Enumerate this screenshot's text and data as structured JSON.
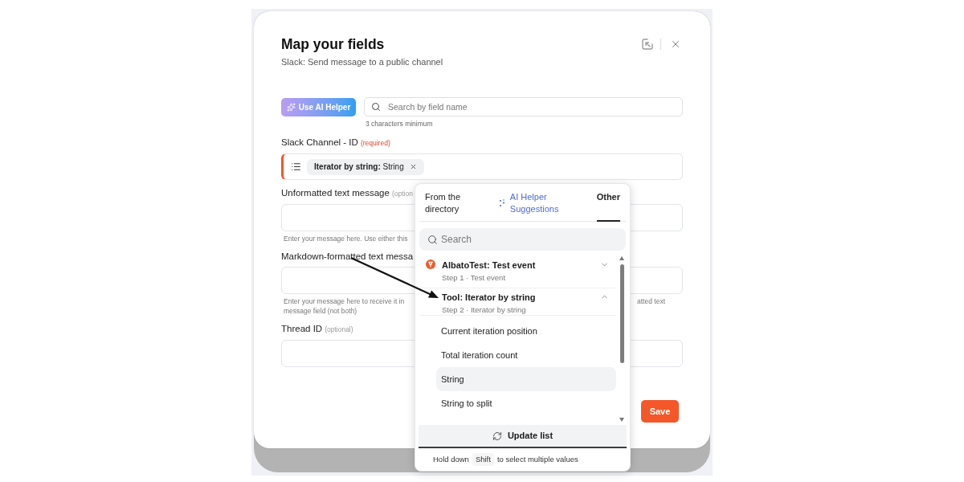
{
  "dialog": {
    "title": "Map your fields",
    "subtitle": "Slack: Send message to a public channel",
    "save_button": "Save"
  },
  "toolbar": {
    "ai_button": "Use AI Helper",
    "search": {
      "placeholder": "Search by field name",
      "hint": "3 characters minimum"
    }
  },
  "fields": [
    {
      "label": "Slack Channel - ID",
      "tag": "(required)",
      "required": true,
      "kind": "mapped",
      "active": true,
      "chip": "**Iterator by string:** String"
    },
    {
      "label": "Unformatted text message",
      "tag": "(option",
      "required": false,
      "kind": "text",
      "active": false,
      "hint": [
        "Enter your message here. Use either this"
      ]
    },
    {
      "label": "Markdown-formatted text messa",
      "kind": "text",
      "active": false,
      "hint": [
        "Enter your message here to receive it in",
        "message field (not both)"
      ],
      "hint_right": "atted text"
    },
    {
      "label": "Thread ID",
      "tag": "(optional)",
      "required": false,
      "kind": "text",
      "active": false
    }
  ],
  "picker": {
    "tabs": [
      {
        "label": "From the directory",
        "kind": "plain",
        "selected": false
      },
      {
        "label": "AI Helper Suggestions",
        "kind": "ai",
        "selected": false
      },
      {
        "label": "Other",
        "kind": "plain",
        "selected": true
      }
    ],
    "search": {
      "placeholder": "Search"
    },
    "groups": [
      {
        "title": "AlbatoTest: Test event",
        "subtitle": "Step 1 · Test event",
        "kind": "app",
        "expanded": false
      },
      {
        "title": "Tool: Iterator by string",
        "subtitle": "Step 2 · Iterator by string",
        "kind": "tool",
        "expanded": true,
        "children": [
          {
            "label": "Current iteration position",
            "selected": false
          },
          {
            "label": "Total iteration count",
            "selected": false
          },
          {
            "label": "String",
            "selected": true
          },
          {
            "label": "String to split",
            "selected": false
          }
        ]
      }
    ],
    "update_button": "Update list",
    "footer": {
      "before": "Hold down",
      "key": "Shift",
      "after": "to select multiple values"
    }
  }
}
